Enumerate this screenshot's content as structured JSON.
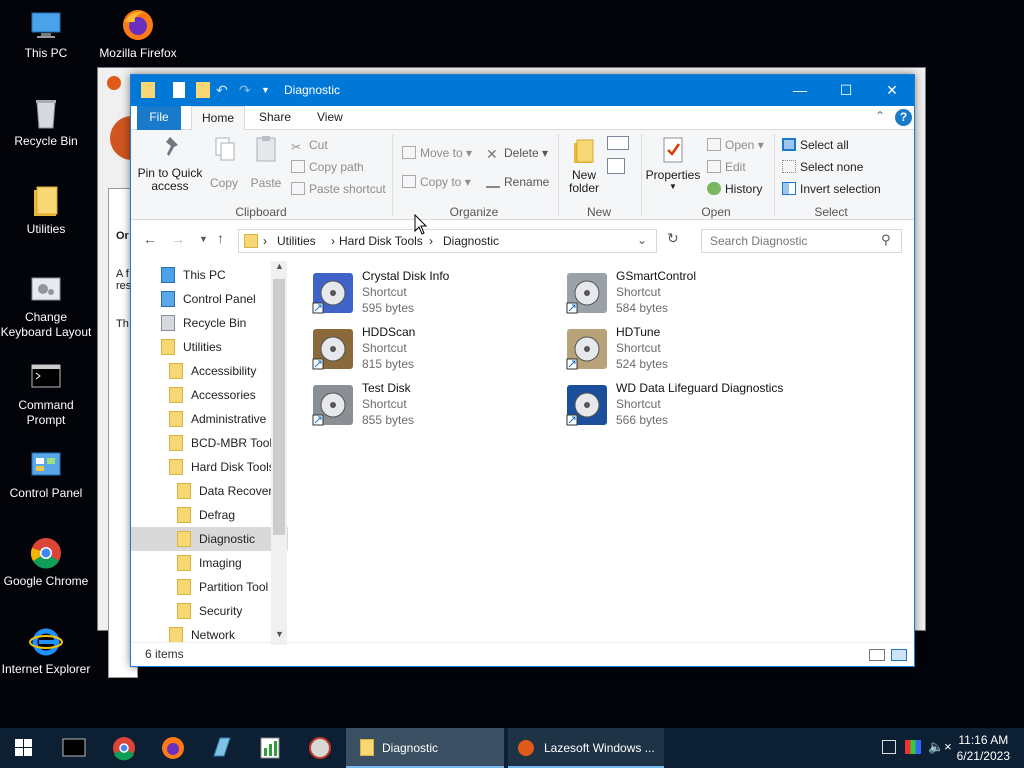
{
  "desktop": {
    "icons": [
      "This PC",
      "Mozilla Firefox",
      "Recycle Bin",
      "Utilities",
      "Change Keyboard Layout",
      "Command Prompt",
      "Control Panel",
      "Google Chrome",
      "Internet Explorer"
    ]
  },
  "bg_window": {
    "lines": [
      "Or",
      "A f",
      "res",
      "Th"
    ]
  },
  "window": {
    "title": "Diagnostic",
    "tabs": [
      "File",
      "Home",
      "Share",
      "View"
    ],
    "ribbon": {
      "pin": "Pin to Quick access",
      "copy": "Copy",
      "paste": "Paste",
      "cut": "Cut",
      "copy_path": "Copy path",
      "paste_shortcut": "Paste shortcut",
      "clipboard": "Clipboard",
      "move_to": "Move to",
      "copy_to": "Copy to",
      "delete": "Delete",
      "rename": "Rename",
      "organize": "Organize",
      "new_folder": "New folder",
      "new": "New",
      "properties": "Properties",
      "open": "Open",
      "edit": "Edit",
      "history": "History",
      "open_group": "Open",
      "select_all": "Select all",
      "select_none": "Select none",
      "invert_selection": "Invert selection",
      "select": "Select"
    },
    "address": {
      "crumbs": [
        "Utilities",
        "Hard Disk Tools",
        "Diagnostic"
      ]
    },
    "search_placeholder": "Search Diagnostic",
    "tree": [
      {
        "label": "This PC",
        "indent": 0
      },
      {
        "label": "Control Panel",
        "indent": 0
      },
      {
        "label": "Recycle Bin",
        "indent": 0
      },
      {
        "label": "Utilities",
        "indent": 0
      },
      {
        "label": "Accessibility",
        "indent": 1
      },
      {
        "label": "Accessories",
        "indent": 1
      },
      {
        "label": "Administrative",
        "indent": 1
      },
      {
        "label": "BCD-MBR Tool",
        "indent": 1
      },
      {
        "label": "Hard Disk Tools",
        "indent": 1
      },
      {
        "label": "Data Recover",
        "indent": 2
      },
      {
        "label": "Defrag",
        "indent": 2
      },
      {
        "label": "Diagnostic",
        "indent": 2,
        "selected": true
      },
      {
        "label": "Imaging",
        "indent": 2
      },
      {
        "label": "Partition Tool",
        "indent": 2
      },
      {
        "label": "Security",
        "indent": 2
      },
      {
        "label": "Network",
        "indent": 1
      }
    ],
    "files": [
      {
        "name": "Crystal Disk Info",
        "type": "Shortcut",
        "size": "595 bytes",
        "icon": "crystal-disk-info-icon"
      },
      {
        "name": "GSmartControl",
        "type": "Shortcut",
        "size": "584 bytes",
        "icon": "gsmartcontrol-icon"
      },
      {
        "name": "HDDScan",
        "type": "Shortcut",
        "size": "815 bytes",
        "icon": "hddscan-icon"
      },
      {
        "name": "HDTune",
        "type": "Shortcut",
        "size": "524 bytes",
        "icon": "hdtune-icon"
      },
      {
        "name": "Test Disk",
        "type": "Shortcut",
        "size": "855 bytes",
        "icon": "testdisk-icon"
      },
      {
        "name": "WD Data Lifeguard Diagnostics",
        "type": "Shortcut",
        "size": "566 bytes",
        "icon": "wd-lifeguard-icon"
      }
    ],
    "status": "6 items"
  },
  "taskbar": {
    "active_window": "Diagnostic",
    "other_window": "Lazesoft Windows ...",
    "time": "11:16 AM",
    "date": "6/21/2023"
  }
}
